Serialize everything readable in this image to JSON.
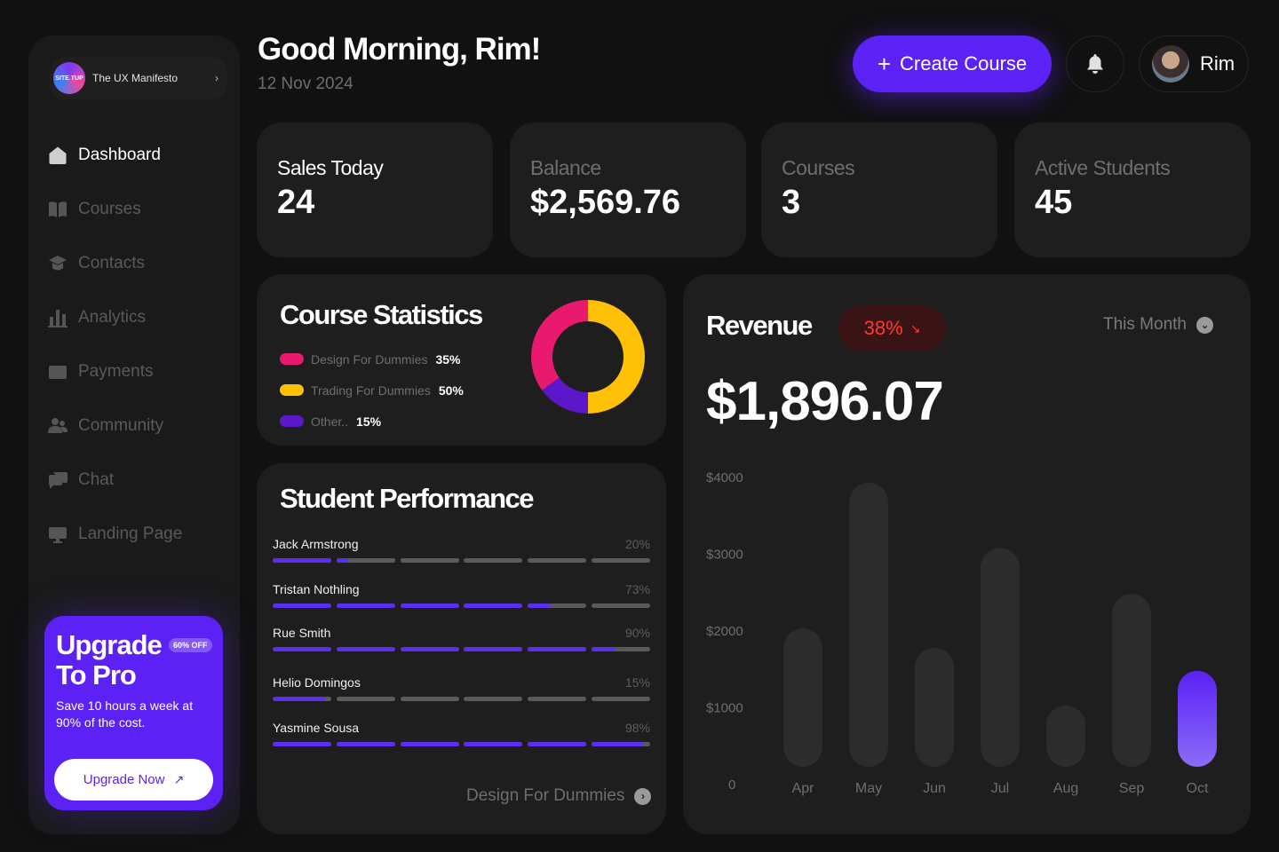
{
  "sidebar": {
    "workspace": {
      "logo_text": "SITE TUP",
      "name": "The UX Manifesto",
      "chevron": "›"
    },
    "nav": [
      {
        "label": "Dashboard",
        "icon": "home-icon",
        "active": true
      },
      {
        "label": "Courses",
        "icon": "book-icon",
        "active": false
      },
      {
        "label": "Contacts",
        "icon": "graduation-cap-icon",
        "active": false
      },
      {
        "label": "Analytics",
        "icon": "bar-chart-icon",
        "active": false
      },
      {
        "label": "Payments",
        "icon": "credit-card-icon",
        "active": false
      },
      {
        "label": "Community",
        "icon": "users-icon",
        "active": false
      },
      {
        "label": "Chat",
        "icon": "chat-icon",
        "active": false
      },
      {
        "label": "Landing Page",
        "icon": "monitor-icon",
        "active": false
      }
    ],
    "upgrade": {
      "title": "Upgrade To Pro",
      "badge": "60% OFF",
      "text": "Save 10 hours a week at 90% of the cost.",
      "button": "Upgrade Now",
      "button_icon": "↗"
    }
  },
  "header": {
    "greeting": "Good Morning, Rim!",
    "date": "12 Nov 2024",
    "create_button": "Create Course",
    "create_icon": "+",
    "user_name": "Rim"
  },
  "stats": [
    {
      "label": "Sales Today",
      "value": "24"
    },
    {
      "label": "Balance",
      "value": "$2,569.76"
    },
    {
      "label": "Courses",
      "value": "3"
    },
    {
      "label": "Active Students",
      "value": "45"
    }
  ],
  "course_statistics": {
    "title": "Course Statistics",
    "items": [
      {
        "name": "Design For Dummies",
        "value": "35%",
        "pct": 35,
        "color": "#e8196f"
      },
      {
        "name": "Trading For Dummies",
        "value": "50%",
        "pct": 50,
        "color": "#ffc107"
      },
      {
        "name": "Other..",
        "value": "15%",
        "pct": 15,
        "color": "#5b17c9"
      }
    ]
  },
  "student_performance": {
    "title": "Student Performance",
    "students": [
      {
        "name": "Jack Armstrong",
        "value": "20%",
        "pct": 20
      },
      {
        "name": "Tristan Nothling",
        "value": "73%",
        "pct": 73
      },
      {
        "name": "Rue Smith",
        "value": "90%",
        "pct": 90
      },
      {
        "name": "Helio Domingos",
        "value": "15%",
        "pct": 15
      },
      {
        "name": "Yasmine Sousa",
        "value": "98%",
        "pct": 98
      }
    ],
    "footer": "Design For Dummies",
    "footer_icon": "›"
  },
  "revenue": {
    "title": "Revenue",
    "change": "38%",
    "trend_icon": "↘",
    "period": "This Month",
    "period_icon": "⌄",
    "amount": "$1,896.07"
  },
  "colors": {
    "accent": "#5b21f5",
    "negative": "#ff3a2f",
    "bar": "#2c2c2c",
    "bar_highlight": "#6b4af0"
  },
  "chart_data": {
    "type": "bar",
    "categories": [
      "Apr",
      "May",
      "Jun",
      "Jul",
      "Aug",
      "Sep",
      "Oct"
    ],
    "values": [
      1800,
      3700,
      1550,
      2850,
      800,
      2250,
      1250
    ],
    "highlight": "Oct",
    "yticks": [
      "0",
      "$1000",
      "$2000",
      "$3000",
      "$4000"
    ],
    "ylim": [
      0,
      4000
    ],
    "title": "",
    "xlabel": "",
    "ylabel": ""
  }
}
